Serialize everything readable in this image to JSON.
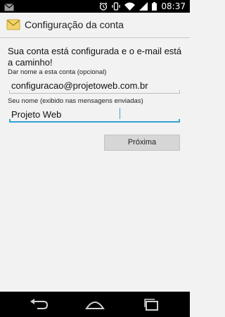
{
  "status_bar": {
    "time": "08:37",
    "icons": [
      "mail-icon",
      "alarm-icon",
      "vibrate-icon",
      "wifi-icon",
      "signal-icon",
      "battery-icon"
    ]
  },
  "action_bar": {
    "icon": "email-app-icon",
    "title": "Configuração da conta"
  },
  "main": {
    "intro": "Sua conta está configurada e o e-mail está a caminho!",
    "account_name": {
      "label": "Dar nome a esta conta (opcional)",
      "value": "configuracao@projetoweb.com.br"
    },
    "your_name": {
      "label": "Seu nome (exibido nas mensagens enviadas)",
      "value": "Projeto Web"
    },
    "next_label": "Próxima"
  },
  "nav_bar": {
    "icons": [
      "back-icon",
      "home-icon",
      "recent-apps-icon"
    ]
  },
  "colors": {
    "focus": "#33a4d4",
    "background": "#f2f2f2",
    "button": "#d6d6d6"
  }
}
